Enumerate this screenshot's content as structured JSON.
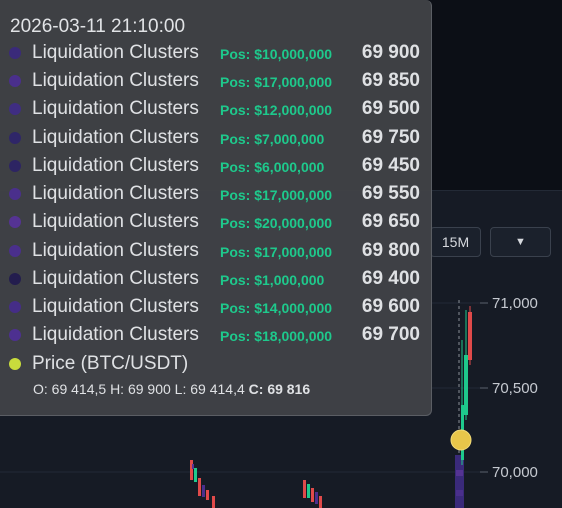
{
  "toolbar": {
    "interval_label": "15M",
    "dropdown_icon": "▼"
  },
  "price_axis": {
    "labels": [
      "71,000",
      "70,500",
      "70,000"
    ]
  },
  "tooltip": {
    "timestamp": "2026-03-11 21:10:00",
    "pos_color": "#1ec98c",
    "rows": [
      {
        "label": "Liquidation Clusters",
        "pos": "Pos: $10,000,000",
        "value": "69 900",
        "color": "#3a2a7a"
      },
      {
        "label": "Liquidation Clusters",
        "pos": "Pos: $17,000,000",
        "value": "69 850",
        "color": "#4a2f8c"
      },
      {
        "label": "Liquidation Clusters",
        "pos": "Pos: $12,000,000",
        "value": "69 500",
        "color": "#3f2d82"
      },
      {
        "label": "Liquidation Clusters",
        "pos": "Pos: $7,000,000",
        "value": "69 750",
        "color": "#2f2668"
      },
      {
        "label": "Liquidation Clusters",
        "pos": "Pos: $6,000,000",
        "value": "69 450",
        "color": "#2d2463"
      },
      {
        "label": "Liquidation Clusters",
        "pos": "Pos: $17,000,000",
        "value": "69 550",
        "color": "#4a2f8c"
      },
      {
        "label": "Liquidation Clusters",
        "pos": "Pos: $20,000,000",
        "value": "69 650",
        "color": "#553393"
      },
      {
        "label": "Liquidation Clusters",
        "pos": "Pos: $17,000,000",
        "value": "69 800",
        "color": "#4a2f8c"
      },
      {
        "label": "Liquidation Clusters",
        "pos": "Pos: $1,000,000",
        "value": "69 400",
        "color": "#231d4e"
      },
      {
        "label": "Liquidation Clusters",
        "pos": "Pos: $14,000,000",
        "value": "69 600",
        "color": "#452d87"
      },
      {
        "label": "Liquidation Clusters",
        "pos": "Pos: $18,000,000",
        "value": "69 700",
        "color": "#4d3090"
      }
    ],
    "price_row": {
      "label": "Price (BTC/USDT)",
      "color": "#c8dc3c"
    },
    "ohlc": {
      "o_label": "O:",
      "o": "69 414,5",
      "h_label": "H:",
      "h": "69 900",
      "l_label": "L:",
      "l": "69 414,4",
      "c_label": "C:",
      "c": "69 816"
    }
  }
}
